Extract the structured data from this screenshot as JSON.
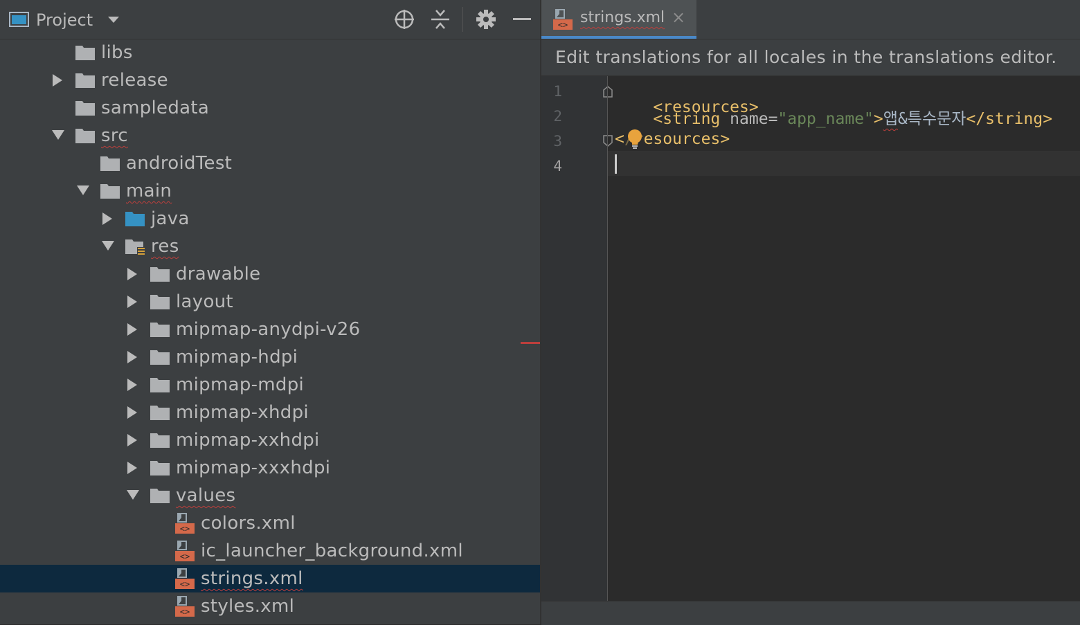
{
  "project_panel": {
    "title": "Project",
    "tree": [
      {
        "label": "libs",
        "depth": 0,
        "icon": "folder-icon",
        "arrow": "none",
        "squiggle": false
      },
      {
        "label": "release",
        "depth": 0,
        "icon": "folder-icon",
        "arrow": "collapsed",
        "squiggle": false
      },
      {
        "label": "sampledata",
        "depth": 0,
        "icon": "folder-icon",
        "arrow": "none",
        "squiggle": false
      },
      {
        "label": "src",
        "depth": 0,
        "icon": "folder-icon",
        "arrow": "expanded",
        "squiggle": true
      },
      {
        "label": "androidTest",
        "depth": 1,
        "icon": "folder-icon",
        "arrow": "none",
        "squiggle": false
      },
      {
        "label": "main",
        "depth": 1,
        "icon": "folder-icon",
        "arrow": "expanded",
        "squiggle": true
      },
      {
        "label": "java",
        "depth": 2,
        "icon": "source-folder-icon",
        "arrow": "collapsed",
        "squiggle": false
      },
      {
        "label": "res",
        "depth": 2,
        "icon": "resource-folder-icon",
        "arrow": "expanded",
        "squiggle": true
      },
      {
        "label": "drawable",
        "depth": 3,
        "icon": "folder-icon",
        "arrow": "collapsed",
        "squiggle": false
      },
      {
        "label": "layout",
        "depth": 3,
        "icon": "folder-icon",
        "arrow": "collapsed",
        "squiggle": false
      },
      {
        "label": "mipmap-anydpi-v26",
        "depth": 3,
        "icon": "folder-icon",
        "arrow": "collapsed",
        "squiggle": false
      },
      {
        "label": "mipmap-hdpi",
        "depth": 3,
        "icon": "folder-icon",
        "arrow": "collapsed",
        "squiggle": false
      },
      {
        "label": "mipmap-mdpi",
        "depth": 3,
        "icon": "folder-icon",
        "arrow": "collapsed",
        "squiggle": false
      },
      {
        "label": "mipmap-xhdpi",
        "depth": 3,
        "icon": "folder-icon",
        "arrow": "collapsed",
        "squiggle": false
      },
      {
        "label": "mipmap-xxhdpi",
        "depth": 3,
        "icon": "folder-icon",
        "arrow": "collapsed",
        "squiggle": false
      },
      {
        "label": "mipmap-xxxhdpi",
        "depth": 3,
        "icon": "folder-icon",
        "arrow": "collapsed",
        "squiggle": false
      },
      {
        "label": "values",
        "depth": 3,
        "icon": "folder-icon",
        "arrow": "expanded",
        "squiggle": true
      },
      {
        "label": "colors.xml",
        "depth": 4,
        "icon": "xml-file-icon",
        "arrow": "none",
        "squiggle": false
      },
      {
        "label": "ic_launcher_background.xml",
        "depth": 4,
        "icon": "xml-file-icon",
        "arrow": "none",
        "squiggle": false
      },
      {
        "label": "strings.xml",
        "depth": 4,
        "icon": "xml-file-icon",
        "arrow": "none",
        "squiggle": true,
        "selected": true
      },
      {
        "label": "styles.xml",
        "depth": 4,
        "icon": "xml-file-icon",
        "arrow": "none",
        "squiggle": false
      }
    ]
  },
  "editor": {
    "tab": {
      "label": "strings.xml",
      "close": "×"
    },
    "banner": "Edit translations for all locales in the translations editor.",
    "line_numbers": [
      "1",
      "2",
      "3",
      "4"
    ],
    "current_line": "4",
    "lines": {
      "l1_tag": "<resources>",
      "l2_indent": "    ",
      "l2_open_start": "<string",
      "l2_attr": " name=",
      "l2_val": "\"app_name\"",
      "l2_open_end": ">",
      "l2_text_1": "앱",
      "l2_text_2": "&특수문자",
      "l2_close": "</string>",
      "l3_tag_a": "<",
      "l3_tag_b": "/r",
      "l3_tag_c": "esources>"
    }
  },
  "colors": {
    "panel_bg": "#3c3f41",
    "editor_bg": "#2b2b2b",
    "selection": "#0d293e",
    "accent": "#4a88c7",
    "tag": "#e8bf6a",
    "string_value": "#6a8759",
    "error": "#bc3f3c"
  }
}
